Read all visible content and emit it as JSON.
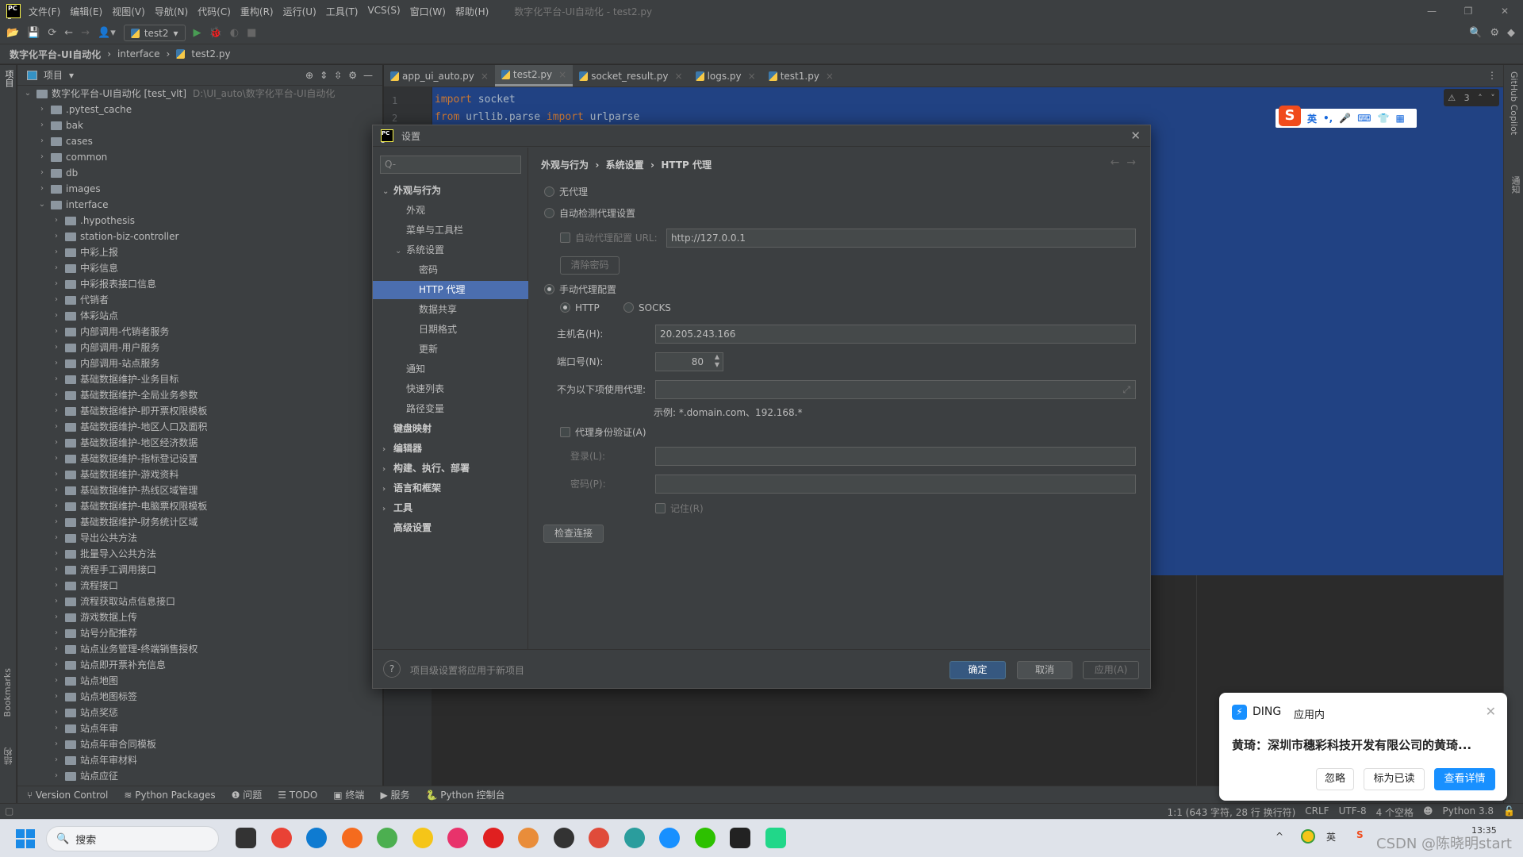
{
  "menubar": {
    "items": [
      "文件(F)",
      "编辑(E)",
      "视图(V)",
      "导航(N)",
      "代码(C)",
      "重构(R)",
      "运行(U)",
      "工具(T)",
      "VCS(S)",
      "窗口(W)",
      "帮助(H)"
    ],
    "title": "数字化平台-UI自动化 - test2.py"
  },
  "toolbar": {
    "run_config": "test2"
  },
  "breadcrumb": [
    "数字化平台-UI自动化",
    "interface",
    "test2.py"
  ],
  "project": {
    "header": "项目",
    "root": "数字化平台-UI自动化 [test_vlt]",
    "root_path": "D:\\UI_auto\\数字化平台-UI自动化",
    "top_items": [
      ".pytest_cache",
      "bak",
      "cases",
      "common",
      "db",
      "images",
      "interface"
    ],
    "interface_children": [
      ".hypothesis",
      "station-biz-controller",
      "中彩上报",
      "中彩信息",
      "中彩报表接口信息",
      "代销者",
      "体彩站点",
      "内部调用-代销者服务",
      "内部调用-用户服务",
      "内部调用-站点服务",
      "基础数据维护-业务目标",
      "基础数据维护-全局业务参数",
      "基础数据维护-即开票权限模板",
      "基础数据维护-地区人口及面积",
      "基础数据维护-地区经济数据",
      "基础数据维护-指标登记设置",
      "基础数据维护-游戏资料",
      "基础数据维护-热线区域管理",
      "基础数据维护-电脑票权限模板",
      "基础数据维护-财务统计区域",
      "导出公共方法",
      "批量导入公共方法",
      "流程手工调用接口",
      "流程接口",
      "流程获取站点信息接口",
      "游戏数据上传",
      "站号分配推荐",
      "站点业务管理-终端销售授权",
      "站点即开票补充信息",
      "站点地图",
      "站点地图标签",
      "站点奖惩",
      "站点年审",
      "站点年审合同模板",
      "站点年审材料",
      "站点应征"
    ]
  },
  "tabs": [
    {
      "label": "app_ui_auto.py"
    },
    {
      "label": "test2.py",
      "active": true
    },
    {
      "label": "socket_result.py"
    },
    {
      "label": "logs.py"
    },
    {
      "label": "test1.py"
    }
  ],
  "editor": {
    "lines": [
      {
        "n": "1",
        "kw1": "import",
        "rest1": " socket",
        "kw2": "",
        "rest2": ""
      },
      {
        "n": "2",
        "kw1": "from",
        "rest1": " urllib.parse ",
        "kw2": "import",
        "rest2": " urlparse"
      }
    ],
    "warnings": "3"
  },
  "ime": {
    "lang": "英",
    "punct": "•,"
  },
  "side_labels": {
    "left_top": "项目",
    "bookmarks": "Bookmarks",
    "structure": "结构",
    "copilot": "GitHub Copilot",
    "notifications": "通知"
  },
  "dialog": {
    "title": "设置",
    "search_placeholder": "Q-",
    "nav": [
      {
        "label": "外观与行为",
        "level": 0,
        "chev": "v",
        "bold": true
      },
      {
        "label": "外观",
        "level": 1
      },
      {
        "label": "菜单与工具栏",
        "level": 1
      },
      {
        "label": "系统设置",
        "level": 1,
        "chev": "v"
      },
      {
        "label": "密码",
        "level": 2
      },
      {
        "label": "HTTP 代理",
        "level": 2,
        "selected": true
      },
      {
        "label": "数据共享",
        "level": 2
      },
      {
        "label": "日期格式",
        "level": 2
      },
      {
        "label": "更新",
        "level": 2
      },
      {
        "label": "通知",
        "level": 1
      },
      {
        "label": "快速列表",
        "level": 1
      },
      {
        "label": "路径变量",
        "level": 1
      },
      {
        "label": "键盘映射",
        "level": 0,
        "bold": true
      },
      {
        "label": "编辑器",
        "level": 0,
        "chev": ">",
        "bold": true
      },
      {
        "label": "构建、执行、部署",
        "level": 0,
        "chev": ">",
        "bold": true
      },
      {
        "label": "语言和框架",
        "level": 0,
        "chev": ">",
        "bold": true
      },
      {
        "label": "工具",
        "level": 0,
        "chev": ">",
        "bold": true
      },
      {
        "label": "高级设置",
        "level": 0,
        "bold": true
      }
    ],
    "crumbs": [
      "外观与行为",
      "系统设置",
      "HTTP 代理"
    ],
    "no_proxy": "无代理",
    "auto_detect": "自动检测代理设置",
    "auto_url_label": "自动代理配置 URL:",
    "auto_url_value": "http://127.0.0.1",
    "clear_pw": "清除密码",
    "manual": "手动代理配置",
    "http": "HTTP",
    "socks": "SOCKS",
    "host_label": "主机名(H):",
    "host_value": "20.205.243.166",
    "port_label": "端口号(N):",
    "port_value": "80",
    "exclude_label": "不为以下项使用代理:",
    "exclude_value": "",
    "example": "示例: *.domain.com、192.168.*",
    "auth": "代理身份验证(A)",
    "login_label": "登录(L):",
    "password_label": "密码(P):",
    "remember": "记住(R)",
    "check": "检查连接",
    "footer_hint": "项目级设置将应用于新项目",
    "ok": "确定",
    "cancel": "取消",
    "apply": "应用(A)"
  },
  "toolwindows": [
    "Version Control",
    "Python Packages",
    "问题",
    "TODO",
    "终端",
    "服务",
    "Python 控制台"
  ],
  "status": {
    "position": "1:1 (643 字符, 28 行 换行符)",
    "line_sep": "CRLF",
    "encoding": "UTF-8",
    "indent": "4 个空格",
    "interpreter": "Python 3.8"
  },
  "notification": {
    "app": "DING",
    "source": "应用内",
    "message": "黄琦：深圳市穗彩科技开发有限公司的黄琦...",
    "ignore": "忽略",
    "mark_read": "标为已读",
    "view": "查看详情"
  },
  "taskbar": {
    "search": "搜索",
    "time": "13:35",
    "tray_ime": "英",
    "watermark": "CSDN @陈晓明start"
  },
  "colors": {
    "selection": "#214283",
    "accent": "#4b6eaf",
    "primary_button": "#365880",
    "ding_blue": "#1890ff"
  }
}
